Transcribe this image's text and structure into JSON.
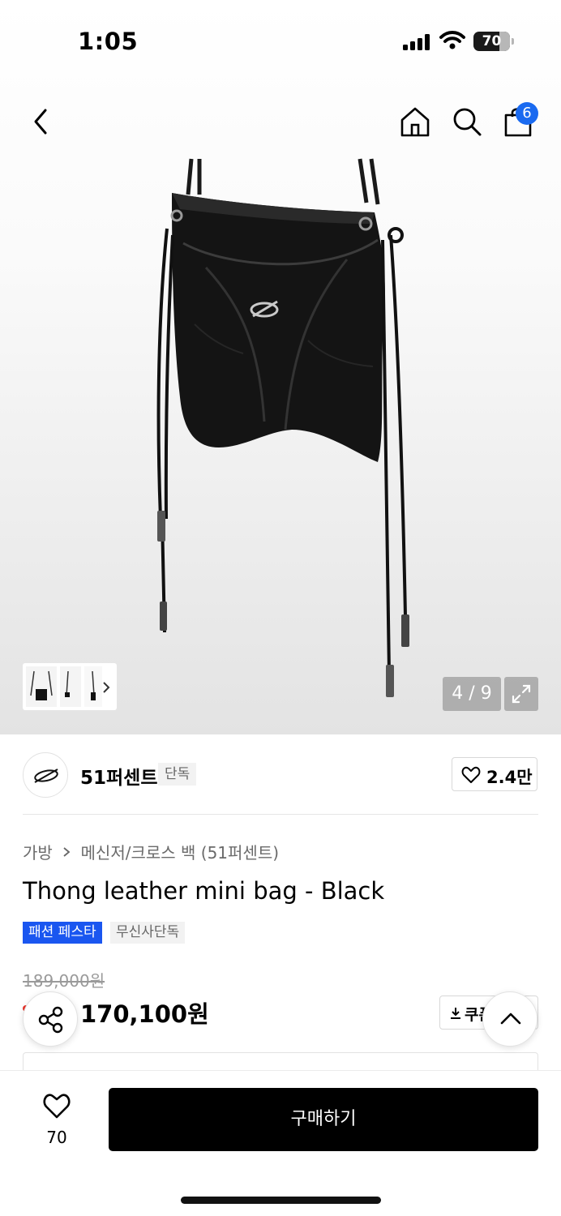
{
  "status_bar": {
    "time": "1:05",
    "battery": "70",
    "battery_level": 0.7
  },
  "nav": {
    "back_icon": "chevron-left-icon",
    "home_icon": "home-icon",
    "search_icon": "search-icon",
    "cart_icon": "shopping-bag-icon",
    "cart_count": "6"
  },
  "gallery": {
    "counter": "4 / 9",
    "expand_icon": "expand-icon",
    "thumb_next_icon": "chevron-right-icon"
  },
  "brand": {
    "name": "51퍼센트",
    "exclusive_tag": "단독",
    "like_count": "2.4만"
  },
  "product": {
    "breadcrumb": [
      "가방",
      "메신저/크로스 백 (51퍼센트)"
    ],
    "title": "Thong leather mini bag - Black",
    "tags": [
      "패션 페스타",
      "무신사단독"
    ],
    "original_price": "189,000원",
    "sale_price": "170,100원",
    "coupon_label": "쿠폰"
  },
  "bottom": {
    "wish_count": "70",
    "buy_label": "구매하기"
  },
  "colors": {
    "accent_blue": "#1a56f0",
    "badge_blue": "#1a6af0",
    "buy_black": "#000000",
    "discount_red": "#e8332a"
  }
}
